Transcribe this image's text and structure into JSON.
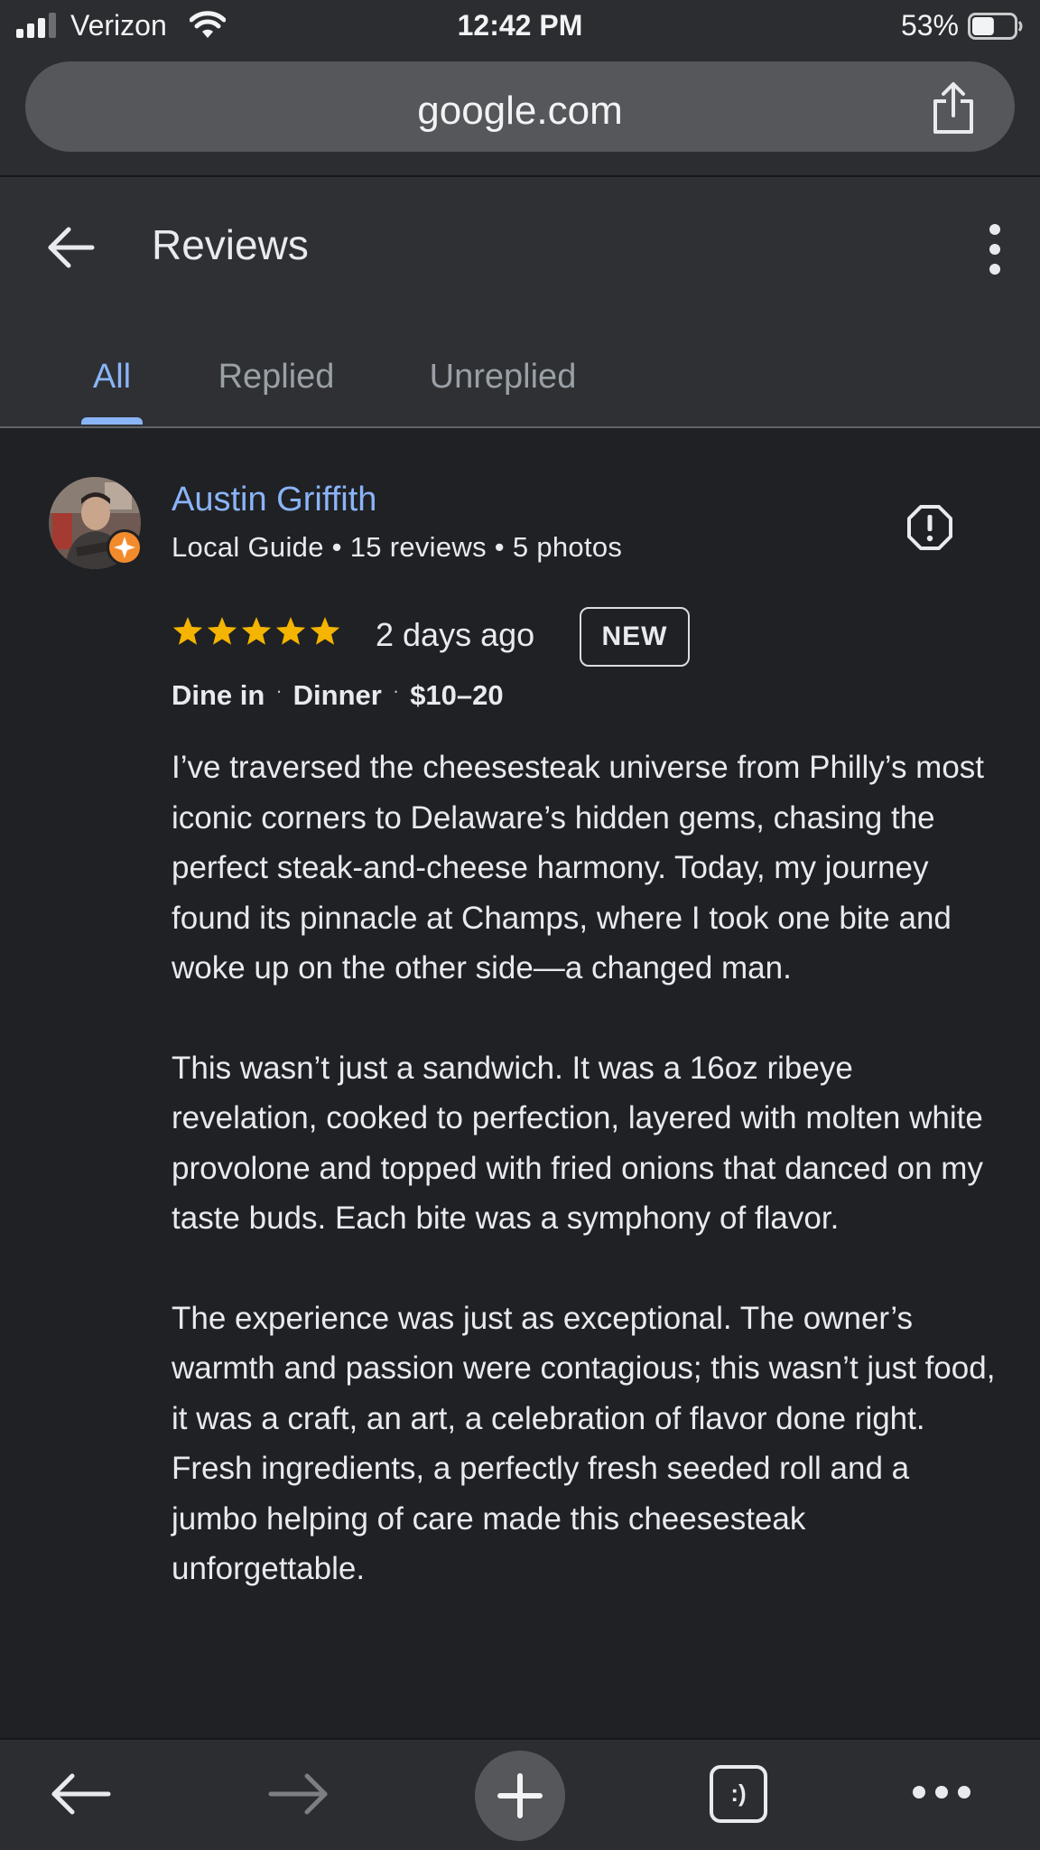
{
  "status_bar": {
    "carrier": "Verizon",
    "time": "12:42 PM",
    "battery": "53%",
    "battery_level": 0.53
  },
  "browser": {
    "url": "google.com"
  },
  "header": {
    "title": "Reviews"
  },
  "tabs": [
    {
      "label": "All",
      "active": true
    },
    {
      "label": "Replied",
      "active": false
    },
    {
      "label": "Unreplied",
      "active": false
    }
  ],
  "review": {
    "author": "Austin Griffith",
    "meta": "Local Guide • 15 reviews • 5 photos",
    "rating": 5,
    "stars": "★★★★★",
    "date": "2 days ago",
    "badge": "NEW",
    "tags": [
      "Dine in",
      "Dinner",
      "$10–20"
    ],
    "paragraphs": [
      "I’ve traversed the cheesesteak universe from Philly’s most iconic corners to Delaware’s hidden gems, chasing the perfect steak-and-cheese harmony. Today, my journey found its pinnacle at Champs, where I took one bite and woke up on the other side—a changed man.",
      "This wasn’t just a sandwich. It was a 16oz ribeye revelation, cooked to perfection, layered with molten white provolone and topped with fried onions that danced on my taste buds. Each bite was a symphony of flavor.",
      "The experience was just as exceptional. The owner’s warmth and passion were contagious; this wasn’t just food, it was a craft, an art, a celebration of flavor done right. Fresh ingredients, a perfectly fresh seeded roll and a jumbo helping of care made this cheesesteak unforgettable."
    ]
  },
  "toolbar": {
    "tabs_glyph": ":)"
  },
  "colors": {
    "accent": "#8ab4f8",
    "star": "#f4b400",
    "badge": "#f28b2c",
    "background": "#202124"
  }
}
